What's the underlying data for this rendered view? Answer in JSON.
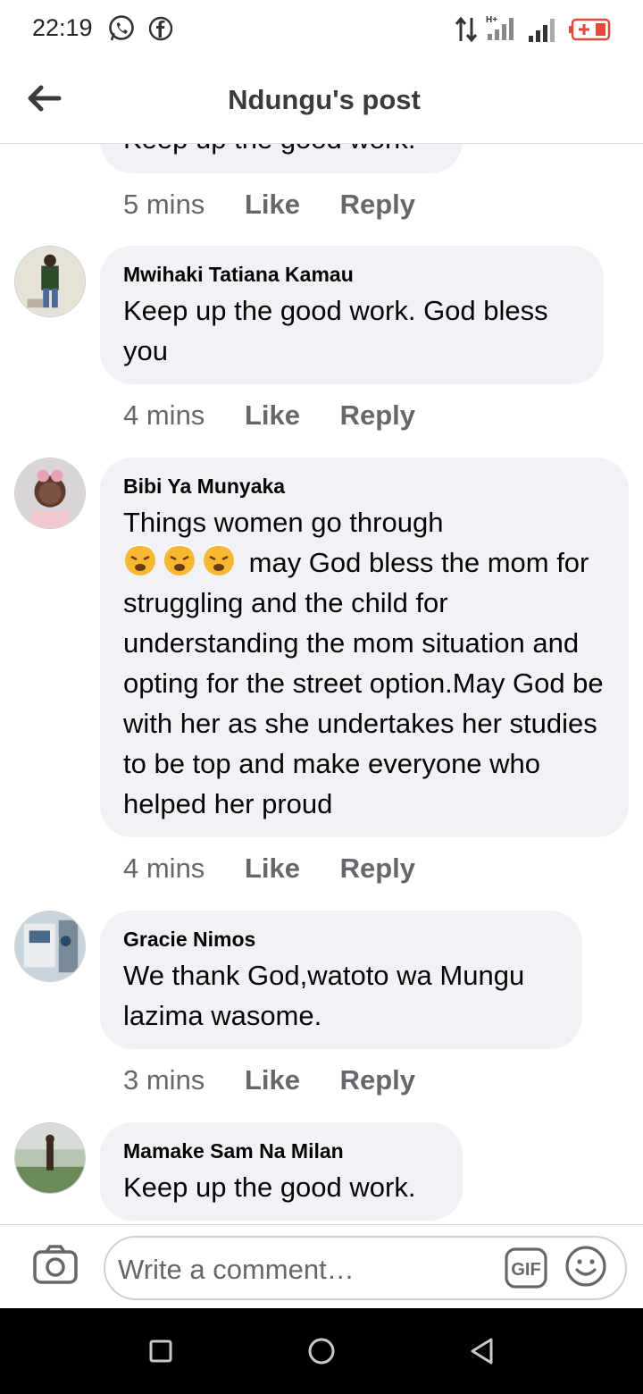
{
  "status_bar": {
    "time": "22:19",
    "network_label": "H+"
  },
  "header": {
    "title": "Ndungu's post"
  },
  "partial_comment": {
    "text": "Keep up the good work.",
    "time": "5 mins",
    "like": "Like",
    "reply": "Reply"
  },
  "comments": [
    {
      "author": "Mwihaki Tatiana Kamau",
      "text": "Keep up the good work. God bless you",
      "time": "4 mins",
      "like": "Like",
      "reply": "Reply"
    },
    {
      "author": "Bibi Ya Munyaka",
      "text_first_line": "Things women go through",
      "emoji": "😩😩😩",
      "text_rest": "may God bless the mom for struggling and the child for understanding the mom situation and opting for the street option.May God be with her as she undertakes her studies to be top and make everyone who helped her proud",
      "time": "4 mins",
      "like": "Like",
      "reply": "Reply"
    },
    {
      "author": "Gracie Nimos",
      "text": "We thank God,watoto wa Mungu lazima wasome.",
      "time": "3 mins",
      "like": "Like",
      "reply": "Reply"
    },
    {
      "author": "Mamake Sam Na Milan",
      "text": "Keep up the good work."
    }
  ],
  "composer": {
    "placeholder": "Write a comment…",
    "gif_label": "GIF"
  },
  "colors": {
    "bubble": "#f0f2f5",
    "meta_text": "#65676b",
    "primary_text": "#050505",
    "divider": "#ccd0d5"
  }
}
